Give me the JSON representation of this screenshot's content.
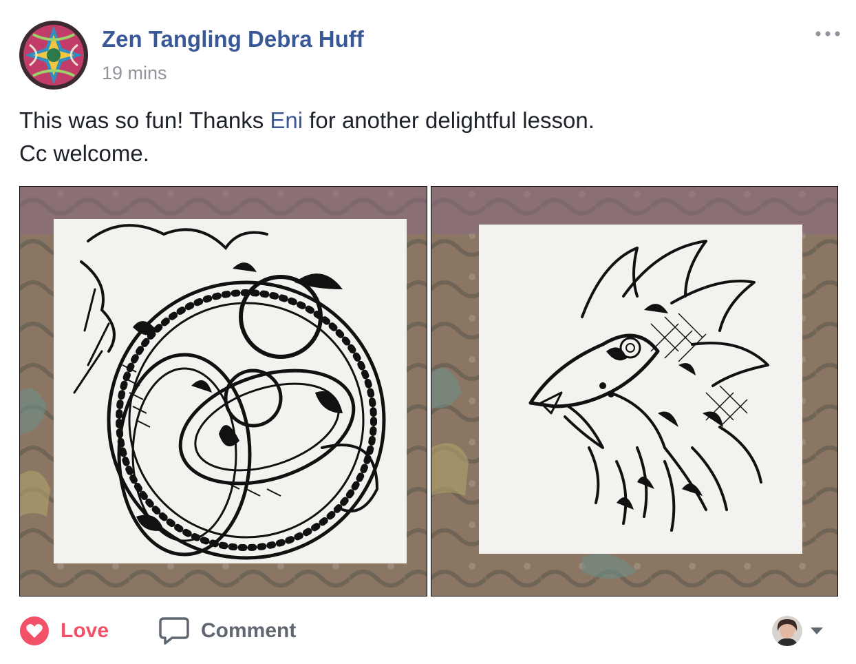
{
  "post": {
    "author": "Zen Tangling Debra Huff",
    "timestamp": "19 mins",
    "text_line1_before": "This was so fun! Thanks ",
    "mention": "Eni",
    "text_line1_after": " for another delightful lesson.",
    "text_line2": "Cc welcome."
  },
  "actions": {
    "love_label": "Love",
    "comment_label": "Comment"
  },
  "icons": {
    "more": "more-options-icon",
    "love": "heart-icon",
    "comment": "speech-bubble-icon",
    "dropdown": "caret-down-icon"
  },
  "colors": {
    "author_link": "#385898",
    "timestamp": "#90949c",
    "love": "#f25268",
    "comment": "#606770",
    "body_text": "#1d2129"
  },
  "photos": [
    {
      "subject": "circular-dragon-zentangle"
    },
    {
      "subject": "dragon-head-zentangle"
    }
  ]
}
